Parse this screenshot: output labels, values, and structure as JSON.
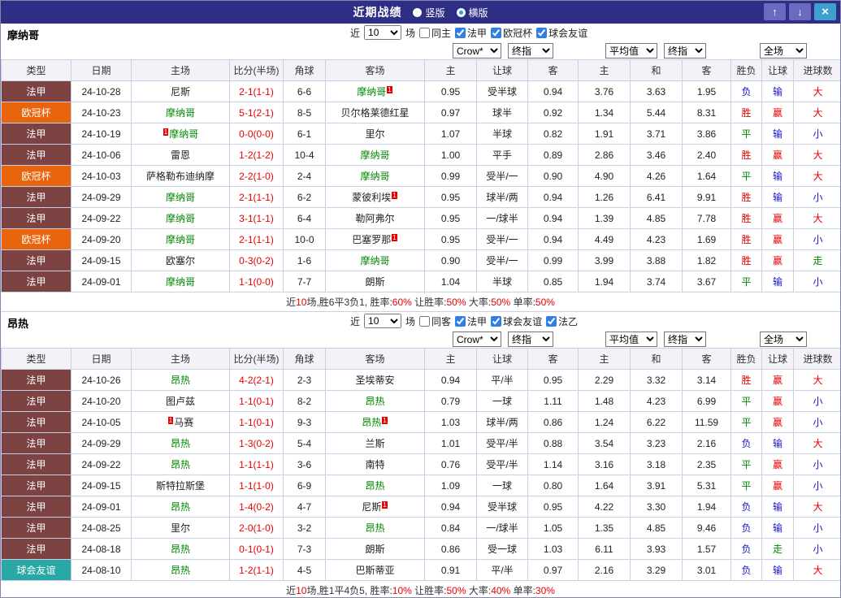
{
  "colors": {
    "titlebar_bg": "#2e2e85",
    "grid_border": "#c9d0e4",
    "header_bg": "#f3f3f7",
    "focus_team_green": "#008800",
    "score_red": "#e80000",
    "result_blue": "#1515cc",
    "checkbox_blue": "#2f7fe8"
  },
  "titlebar": {
    "title": "近期战绩",
    "vertical_label": "竖版",
    "horizontal_label": "横版",
    "selected": "横版"
  },
  "icons": {
    "up": "↑",
    "down": "↓",
    "close": "×"
  },
  "columns": [
    "类型",
    "日期",
    "主场",
    "比分(半场)",
    "角球",
    "客场",
    "主",
    "让球",
    "客",
    "主",
    "和",
    "客",
    "胜负",
    "让球",
    "进球数"
  ],
  "dropdowns": {
    "company": "Crow*",
    "final1": "终指",
    "average": "平均值",
    "final2": "终指",
    "scope": "全场"
  },
  "card_text": "1",
  "type_colors": {
    "法甲": "#7d4343",
    "欧冠杯": "#e8650d",
    "球会友谊": "#2aa7a7"
  },
  "result_colors": {
    "胜": "#e80000",
    "赢": "#e80000",
    "大": "#e80000",
    "平": "#008800",
    "走": "#008800",
    "负": "#1515cc",
    "输": "#1515cc",
    "小": "#1515cc"
  },
  "sections": [
    {
      "team": "摩纳哥",
      "filters": {
        "pre": "近",
        "count": "10",
        "post": "场",
        "checkboxes": [
          {
            "label": "同主",
            "checked": false
          },
          {
            "label": "法甲",
            "checked": true
          },
          {
            "label": "欧冠杯",
            "checked": true
          },
          {
            "label": "球会友谊",
            "checked": true
          }
        ]
      },
      "rows": [
        {
          "type": "法甲",
          "date": "24-10-28",
          "home": {
            "n": "尼斯"
          },
          "score": "2-1(1-1)",
          "corner": "6-6",
          "away": {
            "n": "摩纳哥",
            "f": 1,
            "rc": 1
          },
          "odds": [
            "0.95",
            "受半球",
            "0.94"
          ],
          "avg": [
            "3.76",
            "3.63",
            "1.95"
          ],
          "res": [
            "负",
            "输",
            "大"
          ]
        },
        {
          "type": "欧冠杯",
          "date": "24-10-23",
          "home": {
            "n": "摩纳哥",
            "f": 1
          },
          "score": "5-1(2-1)",
          "corner": "8-5",
          "away": {
            "n": "贝尔格莱德红星"
          },
          "odds": [
            "0.97",
            "球半",
            "0.92"
          ],
          "avg": [
            "1.34",
            "5.44",
            "8.31"
          ],
          "res": [
            "胜",
            "赢",
            "大"
          ]
        },
        {
          "type": "法甲",
          "date": "24-10-19",
          "home": {
            "n": "摩纳哥",
            "f": 1,
            "rc": 1
          },
          "score": "0-0(0-0)",
          "corner": "6-1",
          "away": {
            "n": "里尔"
          },
          "odds": [
            "1.07",
            "半球",
            "0.82"
          ],
          "avg": [
            "1.91",
            "3.71",
            "3.86"
          ],
          "res": [
            "平",
            "输",
            "小"
          ]
        },
        {
          "type": "法甲",
          "date": "24-10-06",
          "home": {
            "n": "雷恩"
          },
          "score": "1-2(1-2)",
          "corner": "10-4",
          "away": {
            "n": "摩纳哥",
            "f": 1
          },
          "odds": [
            "1.00",
            "平手",
            "0.89"
          ],
          "avg": [
            "2.86",
            "3.46",
            "2.40"
          ],
          "res": [
            "胜",
            "赢",
            "大"
          ]
        },
        {
          "type": "欧冠杯",
          "date": "24-10-03",
          "home": {
            "n": "萨格勒布迪纳摩"
          },
          "score": "2-2(1-0)",
          "corner": "2-4",
          "away": {
            "n": "摩纳哥",
            "f": 1
          },
          "odds": [
            "0.99",
            "受半/一",
            "0.90"
          ],
          "avg": [
            "4.90",
            "4.26",
            "1.64"
          ],
          "res": [
            "平",
            "输",
            "大"
          ]
        },
        {
          "type": "法甲",
          "date": "24-09-29",
          "home": {
            "n": "摩纳哥",
            "f": 1
          },
          "score": "2-1(1-1)",
          "corner": "6-2",
          "away": {
            "n": "蒙彼利埃",
            "rc": 1
          },
          "odds": [
            "0.95",
            "球半/两",
            "0.94"
          ],
          "avg": [
            "1.26",
            "6.41",
            "9.91"
          ],
          "res": [
            "胜",
            "输",
            "小"
          ]
        },
        {
          "type": "法甲",
          "date": "24-09-22",
          "home": {
            "n": "摩纳哥",
            "f": 1
          },
          "score": "3-1(1-1)",
          "corner": "6-4",
          "away": {
            "n": "勒阿弗尔"
          },
          "odds": [
            "0.95",
            "一/球半",
            "0.94"
          ],
          "avg": [
            "1.39",
            "4.85",
            "7.78"
          ],
          "res": [
            "胜",
            "赢",
            "大"
          ]
        },
        {
          "type": "欧冠杯",
          "date": "24-09-20",
          "home": {
            "n": "摩纳哥",
            "f": 1
          },
          "score": "2-1(1-1)",
          "corner": "10-0",
          "away": {
            "n": "巴塞罗那",
            "rc": 1
          },
          "odds": [
            "0.95",
            "受半/一",
            "0.94"
          ],
          "avg": [
            "4.49",
            "4.23",
            "1.69"
          ],
          "res": [
            "胜",
            "赢",
            "小"
          ]
        },
        {
          "type": "法甲",
          "date": "24-09-15",
          "home": {
            "n": "欧塞尔"
          },
          "score": "0-3(0-2)",
          "corner": "1-6",
          "away": {
            "n": "摩纳哥",
            "f": 1
          },
          "odds": [
            "0.90",
            "受半/一",
            "0.99"
          ],
          "avg": [
            "3.99",
            "3.88",
            "1.82"
          ],
          "res": [
            "胜",
            "赢",
            "走"
          ]
        },
        {
          "type": "法甲",
          "date": "24-09-01",
          "home": {
            "n": "摩纳哥",
            "f": 1
          },
          "score": "1-1(0-0)",
          "corner": "7-7",
          "away": {
            "n": "朗斯"
          },
          "odds": [
            "1.04",
            "半球",
            "0.85"
          ],
          "avg": [
            "1.94",
            "3.74",
            "3.67"
          ],
          "res": [
            "平",
            "输",
            "小"
          ]
        }
      ],
      "summary": [
        {
          "t": "近",
          "c": "#333333"
        },
        {
          "t": "10",
          "c": "#e80000"
        },
        {
          "t": "场,胜6平3负1, 胜率:",
          "c": "#333333"
        },
        {
          "t": "60%",
          "c": "#e80000"
        },
        {
          "t": " 让胜率:",
          "c": "#333333"
        },
        {
          "t": "50%",
          "c": "#e80000"
        },
        {
          "t": " 大率:",
          "c": "#333333"
        },
        {
          "t": "50%",
          "c": "#e80000"
        },
        {
          "t": " 单率:",
          "c": "#333333"
        },
        {
          "t": "50%",
          "c": "#e80000"
        }
      ]
    },
    {
      "team": "昂热",
      "filters": {
        "pre": "近",
        "count": "10",
        "post": "场",
        "checkboxes": [
          {
            "label": "同客",
            "checked": false
          },
          {
            "label": "法甲",
            "checked": true
          },
          {
            "label": "球会友谊",
            "checked": true
          },
          {
            "label": "法乙",
            "checked": true
          }
        ]
      },
      "rows": [
        {
          "type": "法甲",
          "date": "24-10-26",
          "home": {
            "n": "昂热",
            "f": 1
          },
          "score": "4-2(2-1)",
          "corner": "2-3",
          "away": {
            "n": "圣埃蒂安"
          },
          "odds": [
            "0.94",
            "平/半",
            "0.95"
          ],
          "avg": [
            "2.29",
            "3.32",
            "3.14"
          ],
          "res": [
            "胜",
            "赢",
            "大"
          ]
        },
        {
          "type": "法甲",
          "date": "24-10-20",
          "home": {
            "n": "图卢兹"
          },
          "score": "1-1(0-1)",
          "corner": "8-2",
          "away": {
            "n": "昂热",
            "f": 1
          },
          "odds": [
            "0.79",
            "一球",
            "1.11"
          ],
          "avg": [
            "1.48",
            "4.23",
            "6.99"
          ],
          "res": [
            "平",
            "赢",
            "小"
          ]
        },
        {
          "type": "法甲",
          "date": "24-10-05",
          "home": {
            "n": "马赛",
            "rc": 1
          },
          "score": "1-1(0-1)",
          "corner": "9-3",
          "away": {
            "n": "昂热",
            "f": 1,
            "rc": 1
          },
          "odds": [
            "1.03",
            "球半/两",
            "0.86"
          ],
          "avg": [
            "1.24",
            "6.22",
            "11.59"
          ],
          "res": [
            "平",
            "赢",
            "小"
          ]
        },
        {
          "type": "法甲",
          "date": "24-09-29",
          "home": {
            "n": "昂热",
            "f": 1
          },
          "score": "1-3(0-2)",
          "corner": "5-4",
          "away": {
            "n": "兰斯"
          },
          "odds": [
            "1.01",
            "受平/半",
            "0.88"
          ],
          "avg": [
            "3.54",
            "3.23",
            "2.16"
          ],
          "res": [
            "负",
            "输",
            "大"
          ]
        },
        {
          "type": "法甲",
          "date": "24-09-22",
          "home": {
            "n": "昂热",
            "f": 1
          },
          "score": "1-1(1-1)",
          "corner": "3-6",
          "away": {
            "n": "南特"
          },
          "odds": [
            "0.76",
            "受平/半",
            "1.14"
          ],
          "avg": [
            "3.16",
            "3.18",
            "2.35"
          ],
          "res": [
            "平",
            "赢",
            "小"
          ]
        },
        {
          "type": "法甲",
          "date": "24-09-15",
          "home": {
            "n": "斯特拉斯堡"
          },
          "score": "1-1(1-0)",
          "corner": "6-9",
          "away": {
            "n": "昂热",
            "f": 1
          },
          "odds": [
            "1.09",
            "一球",
            "0.80"
          ],
          "avg": [
            "1.64",
            "3.91",
            "5.31"
          ],
          "res": [
            "平",
            "赢",
            "小"
          ]
        },
        {
          "type": "法甲",
          "date": "24-09-01",
          "home": {
            "n": "昂热",
            "f": 1
          },
          "score": "1-4(0-2)",
          "corner": "4-7",
          "away": {
            "n": "尼斯",
            "rc": 1
          },
          "odds": [
            "0.94",
            "受半球",
            "0.95"
          ],
          "avg": [
            "4.22",
            "3.30",
            "1.94"
          ],
          "res": [
            "负",
            "输",
            "大"
          ]
        },
        {
          "type": "法甲",
          "date": "24-08-25",
          "home": {
            "n": "里尔"
          },
          "score": "2-0(1-0)",
          "corner": "3-2",
          "away": {
            "n": "昂热",
            "f": 1
          },
          "odds": [
            "0.84",
            "一/球半",
            "1.05"
          ],
          "avg": [
            "1.35",
            "4.85",
            "9.46"
          ],
          "res": [
            "负",
            "输",
            "小"
          ]
        },
        {
          "type": "法甲",
          "date": "24-08-18",
          "home": {
            "n": "昂热",
            "f": 1
          },
          "score": "0-1(0-1)",
          "corner": "7-3",
          "away": {
            "n": "朗斯"
          },
          "odds": [
            "0.86",
            "受一球",
            "1.03"
          ],
          "avg": [
            "6.11",
            "3.93",
            "1.57"
          ],
          "res": [
            "负",
            "走",
            "小"
          ]
        },
        {
          "type": "球会友谊",
          "date": "24-08-10",
          "home": {
            "n": "昂热",
            "f": 1
          },
          "score": "1-2(1-1)",
          "corner": "4-5",
          "away": {
            "n": "巴斯蒂亚"
          },
          "odds": [
            "0.91",
            "平/半",
            "0.97"
          ],
          "avg": [
            "2.16",
            "3.29",
            "3.01"
          ],
          "res": [
            "负",
            "输",
            "大"
          ]
        }
      ],
      "summary": [
        {
          "t": "近",
          "c": "#333333"
        },
        {
          "t": "10",
          "c": "#e80000"
        },
        {
          "t": "场,胜1平4负5, 胜率:",
          "c": "#333333"
        },
        {
          "t": "10%",
          "c": "#e80000"
        },
        {
          "t": " 让胜率:",
          "c": "#333333"
        },
        {
          "t": "50%",
          "c": "#e80000"
        },
        {
          "t": " 大率:",
          "c": "#333333"
        },
        {
          "t": "40%",
          "c": "#e80000"
        },
        {
          "t": " 单率:",
          "c": "#333333"
        },
        {
          "t": "30%",
          "c": "#e80000"
        }
      ]
    }
  ]
}
